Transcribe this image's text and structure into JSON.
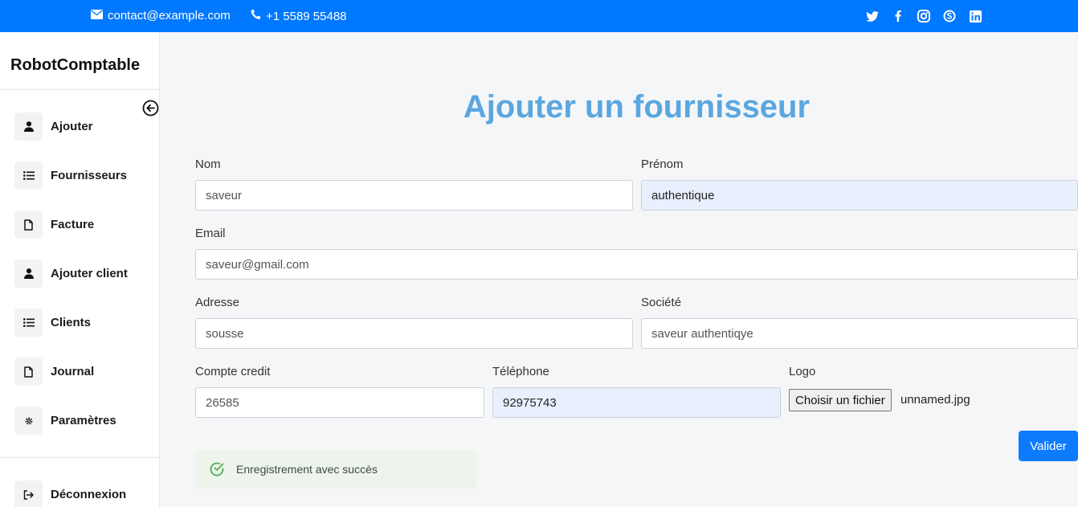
{
  "topbar": {
    "email": "contact@example.com",
    "phone": "+1 5589 55488",
    "social_icons": [
      "twitter-icon",
      "facebook-icon",
      "instagram-icon",
      "skype-icon",
      "linkedin-icon"
    ]
  },
  "sidebar": {
    "brand": "RobotComptable",
    "items": [
      {
        "label": "Ajouter",
        "icon": "user-icon"
      },
      {
        "label": "Fournisseurs",
        "icon": "list-icon"
      },
      {
        "label": "Facture",
        "icon": "file-icon"
      },
      {
        "label": "Ajouter client",
        "icon": "user-icon"
      },
      {
        "label": "Clients",
        "icon": "list-icon"
      },
      {
        "label": "Journal",
        "icon": "file-icon"
      },
      {
        "label": "Paramètres",
        "icon": "gear-icon"
      }
    ],
    "logout": {
      "label": "Déconnexion",
      "icon": "logout-icon"
    }
  },
  "form": {
    "title": "Ajouter un fournisseur",
    "nom": {
      "label": "Nom",
      "value": "saveur"
    },
    "prenom": {
      "label": "Prénom",
      "value": "authentique"
    },
    "email": {
      "label": "Email",
      "value": "saveur@gmail.com"
    },
    "adresse": {
      "label": "Adresse",
      "value": "sousse"
    },
    "societe": {
      "label": "Société",
      "value": "saveur authentiqye"
    },
    "compte": {
      "label": "Compte credit",
      "value": "26585"
    },
    "telephone": {
      "label": "Téléphone",
      "value": "92975743"
    },
    "logo": {
      "label": "Logo",
      "button": "Choisir un fichier",
      "filename": "unnamed.jpg"
    },
    "submit": "Valider"
  },
  "alert": {
    "message": "Enregistrement avec succès"
  },
  "colors": {
    "topbar": "#0078ff",
    "title": "#5aa7e0",
    "button": "#0d7bfd",
    "alert_bg": "#ecf4ec",
    "alert_icon": "#4caf50"
  }
}
